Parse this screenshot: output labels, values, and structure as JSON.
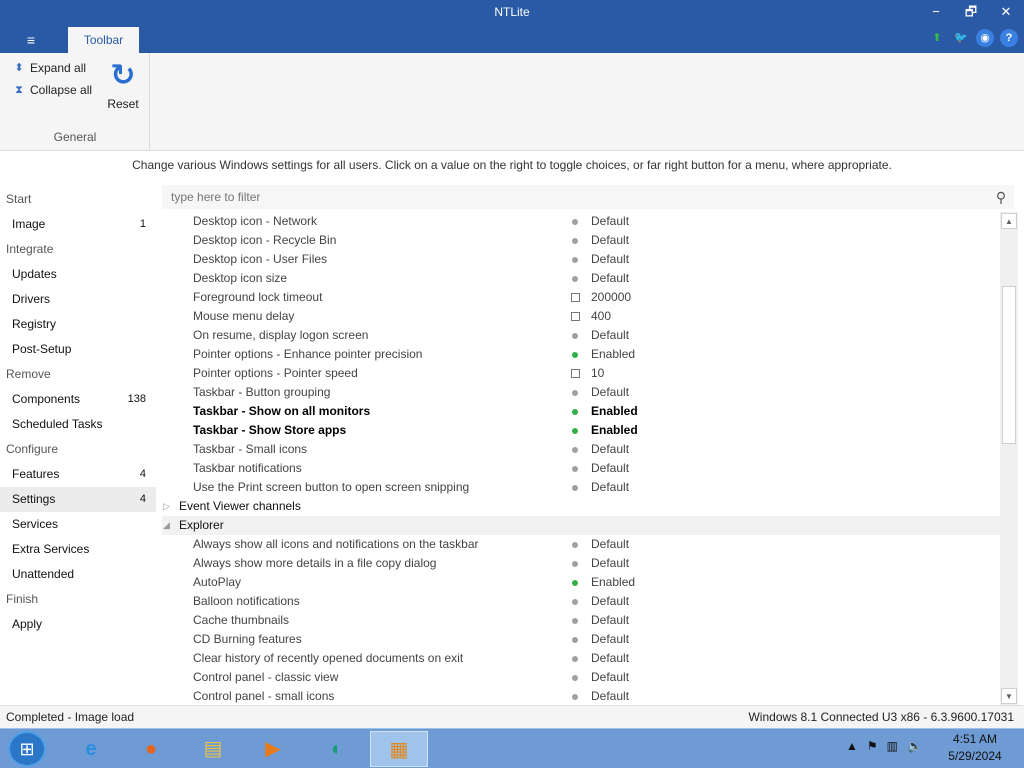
{
  "window": {
    "title": "NTLite",
    "minimize": "−",
    "restore": "🗗",
    "close": "✕"
  },
  "ribbon": {
    "menu_glyph": "≡",
    "tab": "Toolbar",
    "expand_all": "Expand all",
    "collapse_all": "Collapse all",
    "reset": "Reset",
    "group_label": "General",
    "right_icons": [
      "update-icon",
      "twitter-icon",
      "discord-icon",
      "help-icon"
    ]
  },
  "hint": "Change various Windows settings for all users. Click on a value on the right to toggle choices, or far right button for a menu, where appropriate.",
  "sidebar": {
    "start_label": "Start",
    "image": {
      "label": "Image",
      "count": "1"
    },
    "integrate_label": "Integrate",
    "updates": "Updates",
    "drivers": "Drivers",
    "registry": "Registry",
    "post_setup": "Post-Setup",
    "remove_label": "Remove",
    "components": {
      "label": "Components",
      "count": "138"
    },
    "scheduled_tasks": "Scheduled Tasks",
    "configure_label": "Configure",
    "features": {
      "label": "Features",
      "count": "4"
    },
    "settings": {
      "label": "Settings",
      "count": "4"
    },
    "services": "Services",
    "extra_services": "Extra Services",
    "unattended": "Unattended",
    "finish_label": "Finish",
    "apply": "Apply"
  },
  "filter": {
    "placeholder": "type here to filter"
  },
  "list": {
    "rows_a": [
      {
        "name": "Desktop icon - Network",
        "value": "Default"
      },
      {
        "name": "Desktop icon - Recycle Bin",
        "value": "Default"
      },
      {
        "name": "Desktop icon - User Files",
        "value": "Default"
      },
      {
        "name": "Desktop icon size",
        "value": "Default"
      },
      {
        "name": "Foreground lock timeout",
        "value": "200000"
      },
      {
        "name": "Mouse menu delay",
        "value": "400"
      },
      {
        "name": "On resume, display logon screen",
        "value": "Default"
      },
      {
        "name": "Pointer options - Enhance pointer precision",
        "value": "Enabled"
      },
      {
        "name": "Pointer options - Pointer speed",
        "value": "10"
      },
      {
        "name": "Taskbar - Button grouping",
        "value": "Default"
      },
      {
        "name": "Taskbar - Show on all monitors",
        "value": "Enabled"
      },
      {
        "name": "Taskbar - Show Store apps",
        "value": "Enabled"
      },
      {
        "name": "Taskbar - Small icons",
        "value": "Default"
      },
      {
        "name": "Taskbar notifications",
        "value": "Default"
      },
      {
        "name": "Use the Print screen button to open screen snipping",
        "value": "Default"
      }
    ],
    "cat_event_viewer": "Event Viewer channels",
    "cat_explorer": "Explorer",
    "rows_b": [
      {
        "name": "Always show all icons and notifications on the taskbar",
        "value": "Default"
      },
      {
        "name": "Always show more details in a file copy dialog",
        "value": "Default"
      },
      {
        "name": "AutoPlay",
        "value": "Enabled"
      },
      {
        "name": "Balloon notifications",
        "value": "Default"
      },
      {
        "name": "Cache thumbnails",
        "value": "Default"
      },
      {
        "name": "CD Burning features",
        "value": "Default"
      },
      {
        "name": "Clear history of recently opened documents on exit",
        "value": "Default"
      },
      {
        "name": "Control panel - classic view",
        "value": "Default"
      },
      {
        "name": "Control panel - small icons",
        "value": "Default"
      }
    ]
  },
  "status": {
    "left": "Completed - Image load",
    "right": "Windows 8.1 Connected U3 x86 - 6.3.9600.17031"
  },
  "taskbar": {
    "apps": [
      "internet-explorer-icon",
      "firefox-icon",
      "file-explorer-icon",
      "media-player-icon",
      "app-icon",
      "ntlite-icon"
    ],
    "time": "4:51 AM",
    "date": "5/29/2024"
  },
  "colors": {
    "title_bar": "#2a5aa6",
    "enabled_dot": "#33b04a",
    "default_dot": "#a0a0a0",
    "taskbar": "#6e9bd4"
  }
}
